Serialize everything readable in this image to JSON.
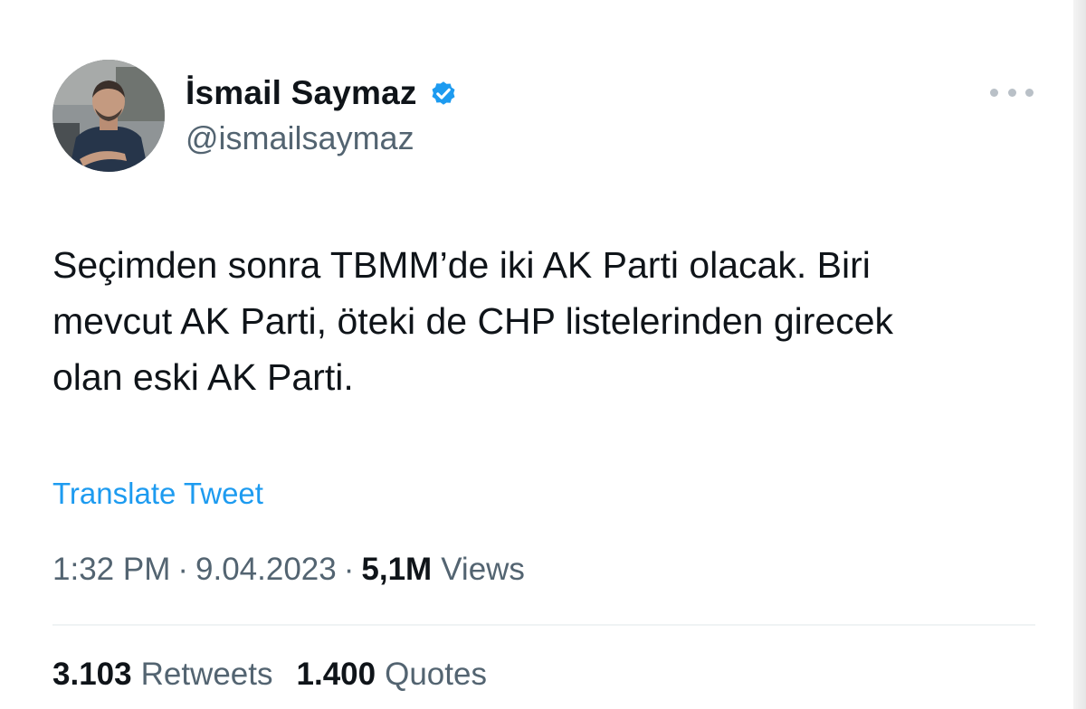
{
  "author": {
    "display_name": "İsmail Saymaz",
    "handle": "@ismailsaymaz",
    "verified_icon": "verified-badge-icon",
    "avatar_icon": "profile-photo"
  },
  "header": {
    "more_icon": "more-options-icon"
  },
  "tweet": {
    "lines": [
      "Seçimden sonra TBMM’de iki AK Parti olacak. Biri",
      "mevcut AK Parti, öteki de CHP listelerinden girecek",
      "olan eski AK Parti."
    ],
    "translate_label": "Translate Tweet"
  },
  "meta": {
    "time": "1:32 PM",
    "separator": "·",
    "date": "9.04.2023",
    "views_count": "5,1M",
    "views_label": "Views"
  },
  "stats": {
    "retweets_count": "3.103",
    "retweets_label": "Retweets",
    "quotes_count": "1.400",
    "quotes_label": "Quotes"
  },
  "colors": {
    "text_primary": "#0f1419",
    "text_secondary": "#536471",
    "link": "#1d9bf0",
    "verified": "#1d9bf0",
    "divider": "#eff3f4"
  }
}
